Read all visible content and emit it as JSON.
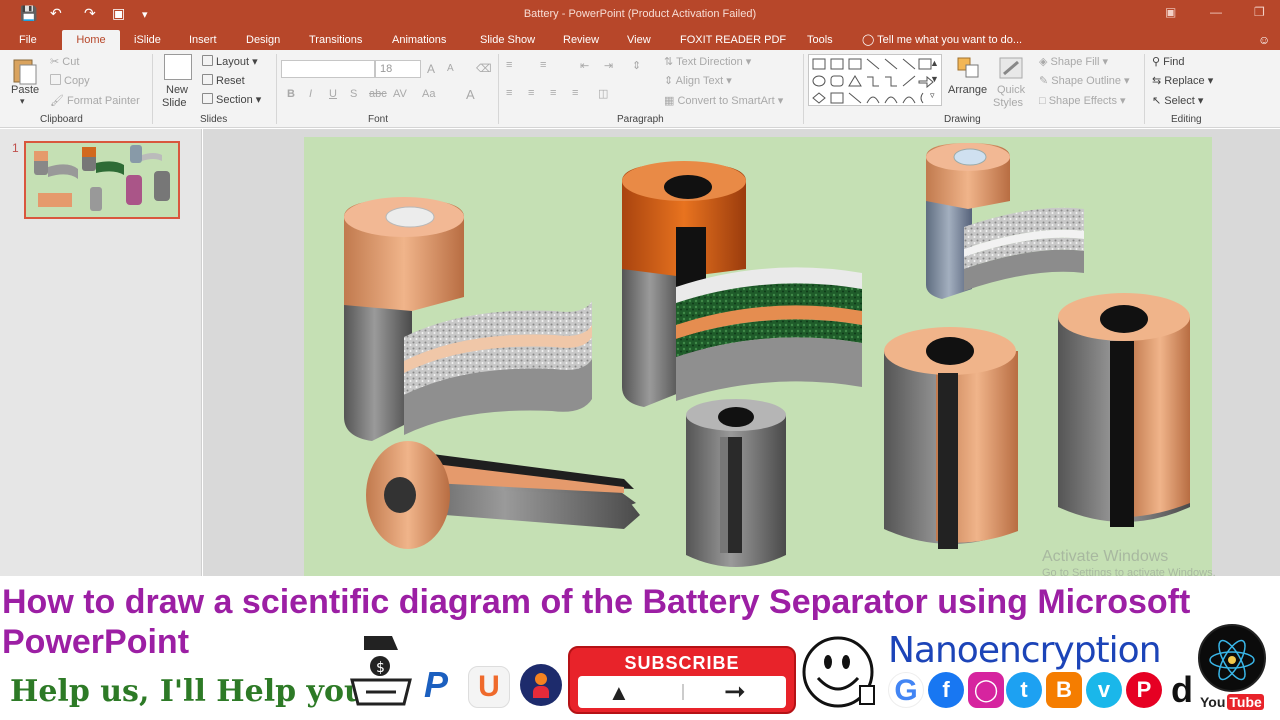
{
  "window": {
    "title": "Battery - PowerPoint (Product Activation Failed)"
  },
  "tabs": [
    {
      "label": "File"
    },
    {
      "label": "Home"
    },
    {
      "label": "iSlide"
    },
    {
      "label": "Insert"
    },
    {
      "label": "Design"
    },
    {
      "label": "Transitions"
    },
    {
      "label": "Animations"
    },
    {
      "label": "Slide Show"
    },
    {
      "label": "Review"
    },
    {
      "label": "View"
    },
    {
      "label": "FOXIT READER PDF"
    },
    {
      "label": "Tools"
    }
  ],
  "tell_me": "Tell me what you want to do...",
  "ribbon": {
    "clipboard": {
      "paste": "Paste",
      "cut": "Cut",
      "copy": "Copy",
      "format_painter": "Format Painter",
      "label": "Clipboard"
    },
    "slides": {
      "new_slide_1": "New",
      "new_slide_2": "Slide",
      "layout": "Layout",
      "reset": "Reset",
      "section": "Section",
      "label": "Slides"
    },
    "font": {
      "size": "18",
      "label": "Font",
      "bold": "B",
      "italic": "I",
      "underline": "U",
      "shadow": "S",
      "strike": "abc",
      "spacing": "AV",
      "case": "Aa",
      "color": "A",
      "grow": "A",
      "shrink": "A"
    },
    "paragraph": {
      "text_direction": "Text Direction",
      "align_text": "Align Text",
      "convert": "Convert to SmartArt",
      "label": "Paragraph"
    },
    "drawing": {
      "arrange": "Arrange",
      "quick_styles_1": "Quick",
      "quick_styles_2": "Styles",
      "shape_fill": "Shape Fill",
      "shape_outline": "Shape Outline",
      "shape_effects": "Shape Effects",
      "label": "Drawing"
    },
    "editing": {
      "find": "Find",
      "replace": "Replace",
      "select": "Select",
      "label": "Editing"
    }
  },
  "thumbnail": {
    "number": "1"
  },
  "watermark": {
    "line1": "Activate Windows",
    "line2": "Go to Settings to activate Windows."
  },
  "banner": {
    "headline": "How to draw a scientific diagram of the Battery Separator using Microsoft PowerPoint",
    "help": "Help us, I'll Help you",
    "subscribe": "SUBSCRIBE",
    "brand": "Nanoencryption",
    "youtube_1": "You",
    "youtube_2": "Tube"
  },
  "colors": {
    "accent": "#b7472a",
    "slide_bg": "#c5e0b4",
    "headline": "#9c1fa4",
    "help": "#2d7a26",
    "copper": "#e59a6c",
    "steel": "#8c8c8c"
  }
}
